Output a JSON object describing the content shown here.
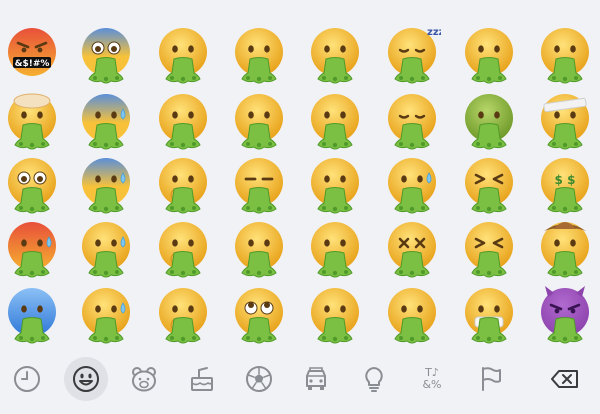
{
  "keyboard": {
    "mode": "emoji",
    "category_selected": "smileys",
    "colors": {
      "face": "#f7c23a",
      "face_shade": "#e8a21a",
      "vomit": "#7bc043",
      "vomit_dark": "#4f9a2a",
      "angry": "#e8503a",
      "fear_blue": "#5b8fd8",
      "sick_green": "#9bc24a",
      "devil": "#8e44ad",
      "icon_gray": "#8a8d93"
    }
  },
  "emoji_grid": {
    "rows": [
      [
        "cursing",
        "scream",
        "vomit-grin",
        "vomit-blush",
        "vomit-plain",
        "vomit-sleep",
        "vomit-woozy",
        "vomit-tongue"
      ],
      [
        "exploding",
        "cold-sweat",
        "raised-brow",
        "vomit-neutral",
        "vomit-plain-2",
        "vomit-relieved",
        "nauseated",
        "bandage"
      ],
      [
        "flushed",
        "anxious-sweat",
        "hand-over-mouth",
        "expressionless",
        "hushed",
        "crying-tear",
        "tired",
        "money-mouth"
      ],
      [
        "angry-sweat",
        "sad-sweat",
        "shushing",
        "grimace",
        "vomit-plain-3",
        "dizzy",
        "squint",
        "cowboy"
      ],
      [
        "cold",
        "downcast-sweat",
        "cursing-hand",
        "rolling-eyes",
        "hushed-2",
        "zipper",
        "mask",
        "devil"
      ]
    ],
    "special_text": {
      "cursing": "&$!#%",
      "sleep": "zzz",
      "money": "$ $"
    }
  },
  "tab_bar": {
    "tabs": [
      {
        "name": "recent",
        "icon": "clock-icon"
      },
      {
        "name": "smileys",
        "icon": "smiley-icon"
      },
      {
        "name": "animals",
        "icon": "bear-icon"
      },
      {
        "name": "food",
        "icon": "cake-icon"
      },
      {
        "name": "activity",
        "icon": "soccer-ball-icon"
      },
      {
        "name": "travel",
        "icon": "car-icon"
      },
      {
        "name": "objects",
        "icon": "lightbulb-icon"
      },
      {
        "name": "symbols",
        "icon": "symbols-icon",
        "text_top": "T♪",
        "text_bottom": "&%"
      },
      {
        "name": "flags",
        "icon": "flag-icon"
      },
      {
        "name": "delete",
        "icon": "backspace-icon"
      }
    ]
  }
}
